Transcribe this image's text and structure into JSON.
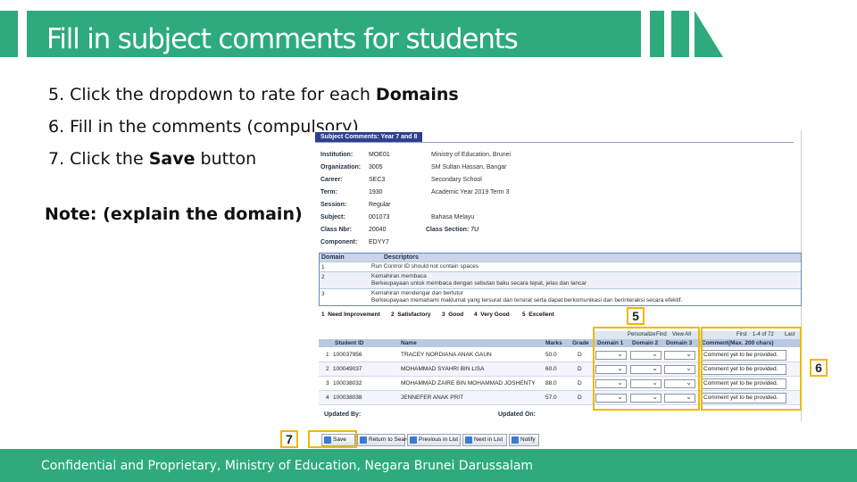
{
  "title": "Fill in subject comments for students",
  "instructions": {
    "step5_prefix": "5. Click the dropdown to rate for each ",
    "step5_bold": "Domains",
    "step6": "6. Fill in the comments (compulsory)",
    "step7_prefix": "7. Click the ",
    "step7_bold": "Save",
    "step7_suffix": " button"
  },
  "note": "Note: (explain the domain)",
  "panel": {
    "tab_label": "Subject Comments: Year 7 and 8",
    "info": [
      {
        "label": "Institution:",
        "value": "MOE01",
        "desc": "Ministry of Education, Brunei"
      },
      {
        "label": "Organization:",
        "value": "3005",
        "desc": "SM Sultan Hassan, Bangar"
      },
      {
        "label": "Career:",
        "value": "SEC3",
        "desc": "Secondary School"
      },
      {
        "label": "Term:",
        "value": "1930",
        "desc": "Academic Year 2019 Term 3"
      },
      {
        "label": "Session:",
        "value": "Regular",
        "desc": ""
      },
      {
        "label": "Subject:",
        "value": "001073",
        "desc": "Bahasa Melayu"
      },
      {
        "label": "Class Nbr:",
        "value": "20040",
        "desc": ""
      },
      {
        "label": "Component:",
        "value": "EDYY7",
        "desc": ""
      }
    ],
    "class_section_label": "Class Section:",
    "class_section_value": "7U",
    "domain_table": {
      "headers": [
        "Domain",
        "Descriptors"
      ],
      "rows": [
        {
          "num": "1",
          "text": "Run Control ID should not contain spaces"
        },
        {
          "num": "2",
          "text": "Kemahiran membaca\nBerkeupayaan untuk membaca dengan sebutan baku secara tepat, jelas dan lancar"
        },
        {
          "num": "3",
          "text": "Kemahiran mendengar dan bertutur\nBerkeupayaan memahami maklumat yang tersurat dan tersirat serta dapat berkomunikasi dan berinteraksi secara efektif."
        }
      ]
    },
    "legend": [
      {
        "num": "1",
        "label": "Need Improvement"
      },
      {
        "num": "2",
        "label": "Satisfactory"
      },
      {
        "num": "3",
        "label": "Good"
      },
      {
        "num": "4",
        "label": "Very Good"
      },
      {
        "num": "5",
        "label": "Excellent"
      }
    ],
    "grid_toolbar": {
      "personalize": "Personalize",
      "find": "Find",
      "view_all": "View All",
      "first": "First",
      "range": "1-4 of 72",
      "last": "Last"
    },
    "grid_headers": {
      "student_id": "Student ID",
      "name": "Name",
      "marks": "Marks",
      "grade": "Grade",
      "domain1": "Domain 1",
      "domain2": "Domain 2",
      "domain3": "Domain 3",
      "comment": "Comment(Max. 200 chars)"
    },
    "students": [
      {
        "idx": "1",
        "id": "100037956",
        "name": "TRACEY NORDIANA ANAK GAUN",
        "marks": "50.0",
        "grade": "D",
        "comment": "Comment yet to be provided."
      },
      {
        "idx": "2",
        "id": "100049037",
        "name": "MOHAMMAD SYAHRI BIN LISA",
        "marks": "60.0",
        "grade": "D",
        "comment": "Comment yet to be provided."
      },
      {
        "idx": "3",
        "id": "100038032",
        "name": "MOHAMMAD ZAIRE BIN MOHAMMAD JOSHENTY",
        "marks": "88.0",
        "grade": "D",
        "comment": "Comment yet to be provided."
      },
      {
        "idx": "4",
        "id": "100038038",
        "name": "JENNEFER ANAK PRIT",
        "marks": "57.0",
        "grade": "D",
        "comment": "Comment yet to be provided."
      }
    ],
    "updated_by": "Updated By:",
    "updated_on": "Updated On:",
    "buttons": [
      {
        "label": "Save"
      },
      {
        "label": "Return to Search"
      },
      {
        "label": "Previous in List"
      },
      {
        "label": "Next in List"
      },
      {
        "label": "Notify"
      }
    ]
  },
  "markers": {
    "m5": "5",
    "m6": "6",
    "m7": "7"
  },
  "footer": "Confidential and Proprietary, Ministry of Education, Negara Brunei Darussalam",
  "colors": {
    "brand_green": "#2eaa7c",
    "highlight": "#f1b800",
    "ps_header": "#2f3f8e"
  }
}
